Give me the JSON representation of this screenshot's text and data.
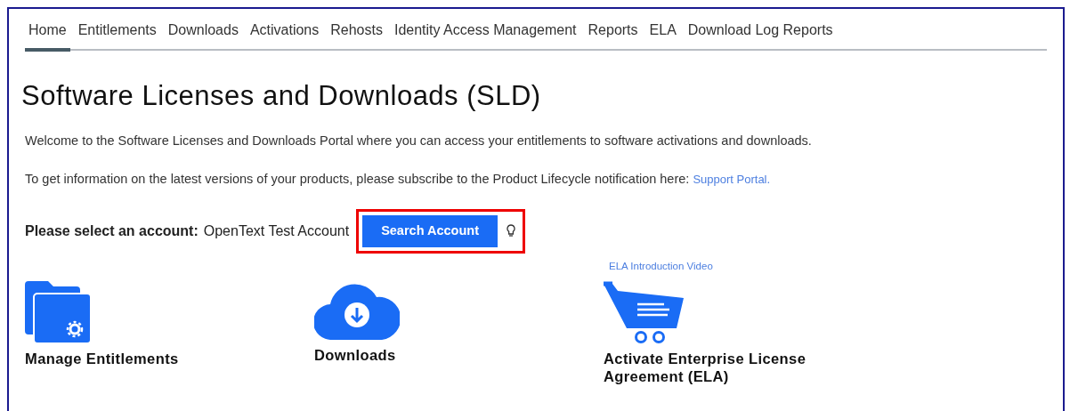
{
  "nav": {
    "tabs": [
      {
        "label": "Home",
        "selected": true
      },
      {
        "label": "Entitlements",
        "selected": false
      },
      {
        "label": "Downloads",
        "selected": false
      },
      {
        "label": "Activations",
        "selected": false
      },
      {
        "label": "Rehosts",
        "selected": false
      },
      {
        "label": "Identity Access Management",
        "selected": false
      },
      {
        "label": "Reports",
        "selected": false
      },
      {
        "label": "ELA",
        "selected": false
      },
      {
        "label": "Download Log Reports",
        "selected": false
      }
    ]
  },
  "title": "Software Licenses and Downloads (SLD)",
  "welcome": "Welcome to the Software Licenses and Downloads Portal where you can access your entitlements to software activations and downloads.",
  "info": {
    "text": "To get information on the latest versions of your products, please subscribe to the Product Lifecycle notification here:",
    "link": "Support Portal."
  },
  "account": {
    "label": "Please select an account:",
    "value": "OpenText Test Account",
    "button": "Search Account",
    "highlighted": true
  },
  "video_link": "ELA Introduction Video",
  "tiles": [
    {
      "kind": "folder",
      "label": "Manage Entitlements"
    },
    {
      "kind": "cloud",
      "label": "Downloads"
    },
    {
      "kind": "cart",
      "label": "Activate Enterprise License Agreement (ELA)"
    }
  ]
}
